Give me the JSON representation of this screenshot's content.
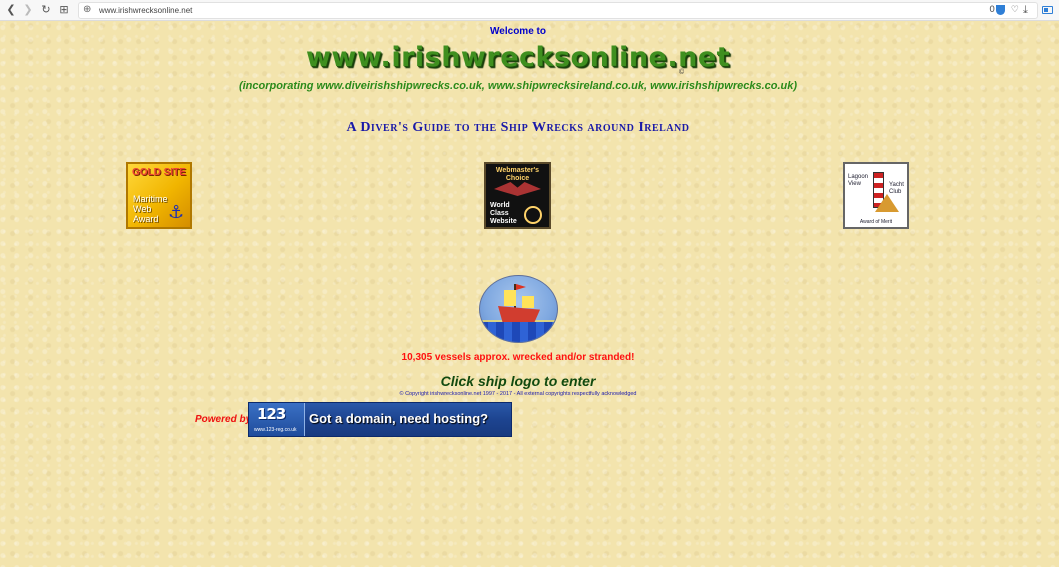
{
  "browser": {
    "url": "www.irishwrecksonline.net",
    "badge_count": "0"
  },
  "page": {
    "welcome": "Welcome to",
    "site_title": "www.irishwrecksonline.net",
    "copyright_symbol": "©",
    "incorporating": "(incorporating www.diveirishshipwrecks.co.uk, www.shipwrecksireland.co.uk, www.irishshipwrecks.co.uk)",
    "tagline": "A Diver's Guide to the Ship Wrecks around Ireland",
    "vessel_count_text": "10,305 vessels approx. wrecked and/or stranded!",
    "enter_prompt": "Click ship logo to enter",
    "copyright_notice": "© Copyright irishwrecksonline.net 1997 - 2017 - All external copyrights respectfully acknowledged",
    "powered_by": "Powered by"
  },
  "awards": {
    "gold": {
      "line1": "GOLD SITE",
      "line2": "Maritime Web Award"
    },
    "webmaster": {
      "line1": "Webmaster's Choice",
      "line2": "World Class Website"
    },
    "lagoon": {
      "line1": "Lagoon View",
      "line2": "Yacht Club",
      "line3": "Award of Merit"
    }
  },
  "banner": {
    "logo": "123",
    "logo_sub": "www.123-reg.co.uk",
    "text": "Got a domain, need hosting?"
  },
  "colors": {
    "background": "#f3e4ad",
    "title_green": "#3f8f1f",
    "link_blue": "#0000cc",
    "alert_red": "#ff1010"
  }
}
